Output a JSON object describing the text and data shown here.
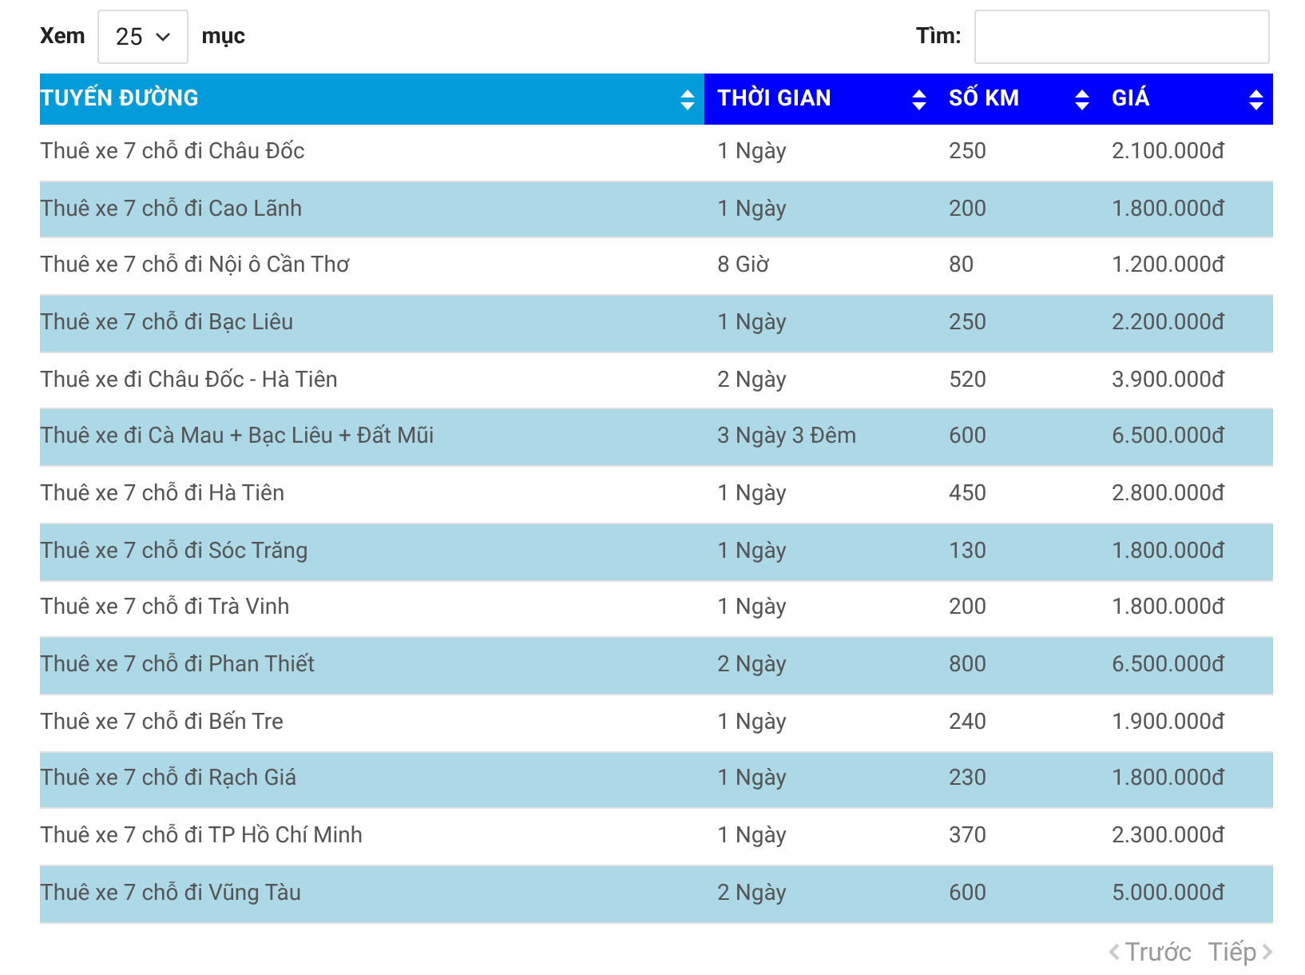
{
  "length_control": {
    "label_before": "Xem",
    "value": "25",
    "label_after": "mục"
  },
  "search": {
    "label": "Tìm:"
  },
  "table": {
    "columns": [
      {
        "label": "TUYẾN ĐƯỜNG",
        "sorted": true
      },
      {
        "label": "THỜI GIAN",
        "sorted": false
      },
      {
        "label": "SỐ KM",
        "sorted": false
      },
      {
        "label": "GIÁ",
        "sorted": false
      }
    ],
    "rows": [
      [
        "Thuê xe 7 chỗ đi Châu Đốc",
        "1 Ngày",
        "250",
        "2.100.000đ"
      ],
      [
        "Thuê xe 7 chỗ đi Cao Lãnh",
        "1 Ngày",
        "200",
        "1.800.000đ"
      ],
      [
        "Thuê xe 7 chỗ đi Nội ô Cần Thơ",
        "8 Giờ",
        "80",
        "1.200.000đ"
      ],
      [
        "Thuê xe 7 chỗ đi Bạc Liêu",
        "1 Ngày",
        "250",
        "2.200.000đ"
      ],
      [
        "Thuê xe đi Châu Đốc - Hà Tiên",
        "2 Ngày",
        "520",
        "3.900.000đ"
      ],
      [
        "Thuê xe đi Cà Mau + Bạc Liêu + Đất Mũi",
        "3 Ngày 3 Đêm",
        "600",
        "6.500.000đ"
      ],
      [
        "Thuê xe 7 chỗ đi Hà Tiên",
        "1 Ngày",
        "450",
        "2.800.000đ"
      ],
      [
        "Thuê xe 7 chỗ đi Sóc Trăng",
        "1 Ngày",
        "130",
        "1.800.000đ"
      ],
      [
        "Thuê xe 7 chỗ đi Trà Vinh",
        "1 Ngày",
        "200",
        "1.800.000đ"
      ],
      [
        "Thuê xe 7 chỗ đi Phan Thiết",
        "2 Ngày",
        "800",
        "6.500.000đ"
      ],
      [
        "Thuê xe 7 chỗ đi Bến Tre",
        "1 Ngày",
        "240",
        "1.900.000đ"
      ],
      [
        "Thuê xe 7 chỗ đi Rạch Giá",
        "1 Ngày",
        "230",
        "1.800.000đ"
      ],
      [
        "Thuê xe 7 chỗ đi TP Hồ Chí Minh",
        "1 Ngày",
        "370",
        "2.300.000đ"
      ],
      [
        "Thuê xe 7 chỗ đi Vũng Tàu",
        "2 Ngày",
        "600",
        "5.000.000đ"
      ]
    ]
  },
  "pagination": {
    "previous": {
      "label": "Trước",
      "disabled": true
    },
    "next": {
      "label": "Tiếp",
      "disabled": true
    }
  }
}
